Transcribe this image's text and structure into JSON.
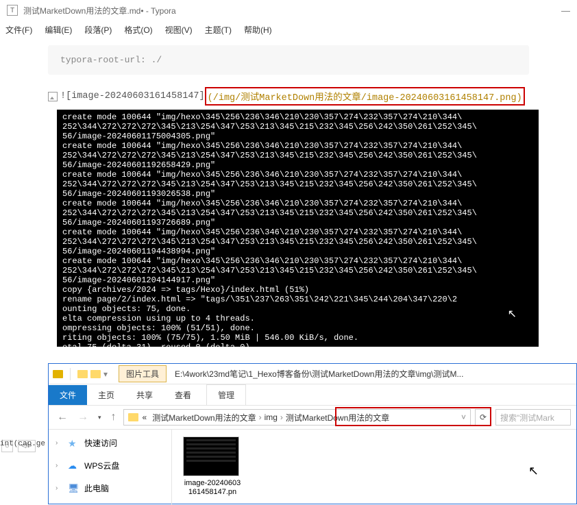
{
  "window": {
    "icon": "T",
    "title": "测试MarketDown用法的文章.md• - Typora"
  },
  "menu": {
    "file": "文件(F)",
    "edit": "编辑(E)",
    "paragraph": "段落(P)",
    "format": "格式(O)",
    "view": "视图(V)",
    "theme": "主题(T)",
    "help": "帮助(H)"
  },
  "frontmatter": "typora-root-url: ./",
  "img_syntax": {
    "alt": "![image-20240603161458147]",
    "path": "(/img/测试MarketDown用法的文章/image-20240603161458147.png)"
  },
  "terminal": "create mode 100644 \"img/hexo\\345\\256\\236\\346\\210\\230\\357\\274\\232\\357\\274\\210\\344\\\n252\\344\\272\\272\\272\\345\\213\\254\\347\\253\\213\\345\\215\\232\\345\\256\\242\\350\\261\\252\\345\\\n56/image-20240601175004305.png\"\ncreate mode 100644 \"img/hexo\\345\\256\\236\\346\\210\\230\\357\\274\\232\\357\\274\\210\\344\\\n252\\344\\272\\272\\272\\345\\213\\254\\347\\253\\213\\345\\215\\232\\345\\256\\242\\350\\261\\252\\345\\\n56/image-20240601192658429.png\"\ncreate mode 100644 \"img/hexo\\345\\256\\236\\346\\210\\230\\357\\274\\232\\357\\274\\210\\344\\\n252\\344\\272\\272\\272\\345\\213\\254\\347\\253\\213\\345\\215\\232\\345\\256\\242\\350\\261\\252\\345\\\n56/image-20240601193026538.png\"\ncreate mode 100644 \"img/hexo\\345\\256\\236\\346\\210\\230\\357\\274\\232\\357\\274\\210\\344\\\n252\\344\\272\\272\\272\\345\\213\\254\\347\\253\\213\\345\\215\\232\\345\\256\\242\\350\\261\\252\\345\\\n56/image-20240601193726689.png\"\ncreate mode 100644 \"img/hexo\\345\\256\\236\\346\\210\\230\\357\\274\\232\\357\\274\\210\\344\\\n252\\344\\272\\272\\272\\345\\213\\254\\347\\253\\213\\345\\215\\232\\345\\256\\242\\350\\261\\252\\345\\\n56/image-20240601194438994.png\"\ncreate mode 100644 \"img/hexo\\345\\256\\236\\346\\210\\230\\357\\274\\232\\357\\274\\210\\344\\\n252\\344\\272\\272\\272\\345\\213\\254\\347\\253\\213\\345\\215\\232\\345\\256\\242\\350\\261\\252\\345\\\n56/image-20240601204144917.png\"\ncopy {archives/2024 => tags/Hexo}/index.html (51%)\nrename page/2/index.html => \"tags/\\351\\237\\263\\351\\242\\221\\345\\244\\204\\347\\220\\2\nounting objects: 75, done.\nelta compression using up to 4 threads.\nompressing objects: 100% (51/51), done.\nriting objects: 100% (75/75), 1.50 MiB | 546.00 KiB/s, done.\notal 75 (delta 31), reused 0 (delta 0)",
  "explorer": {
    "context_tab": "图片工具",
    "title_path": "E:\\4work\\23md笔记\\1_Hexo博客备份\\测试MarketDown用法的文章\\img\\测试M...",
    "ribbon": {
      "file": "文件",
      "home": "主页",
      "share": "共享",
      "view": "查看",
      "manage": "管理"
    },
    "breadcrumb": {
      "pre": "«",
      "seg1": "测试MarketDown用法的文章",
      "seg2": "img",
      "seg3": "测试MarketDown用法的文章"
    },
    "search_placeholder": "搜索\"测试Mark",
    "nav": {
      "quick": "快速访问",
      "wps": "WPS云盘",
      "thispc": "此电脑"
    },
    "file_label": "image-20240603161458147.pn"
  },
  "gutter": {
    "cap": "int(cap.ge"
  }
}
